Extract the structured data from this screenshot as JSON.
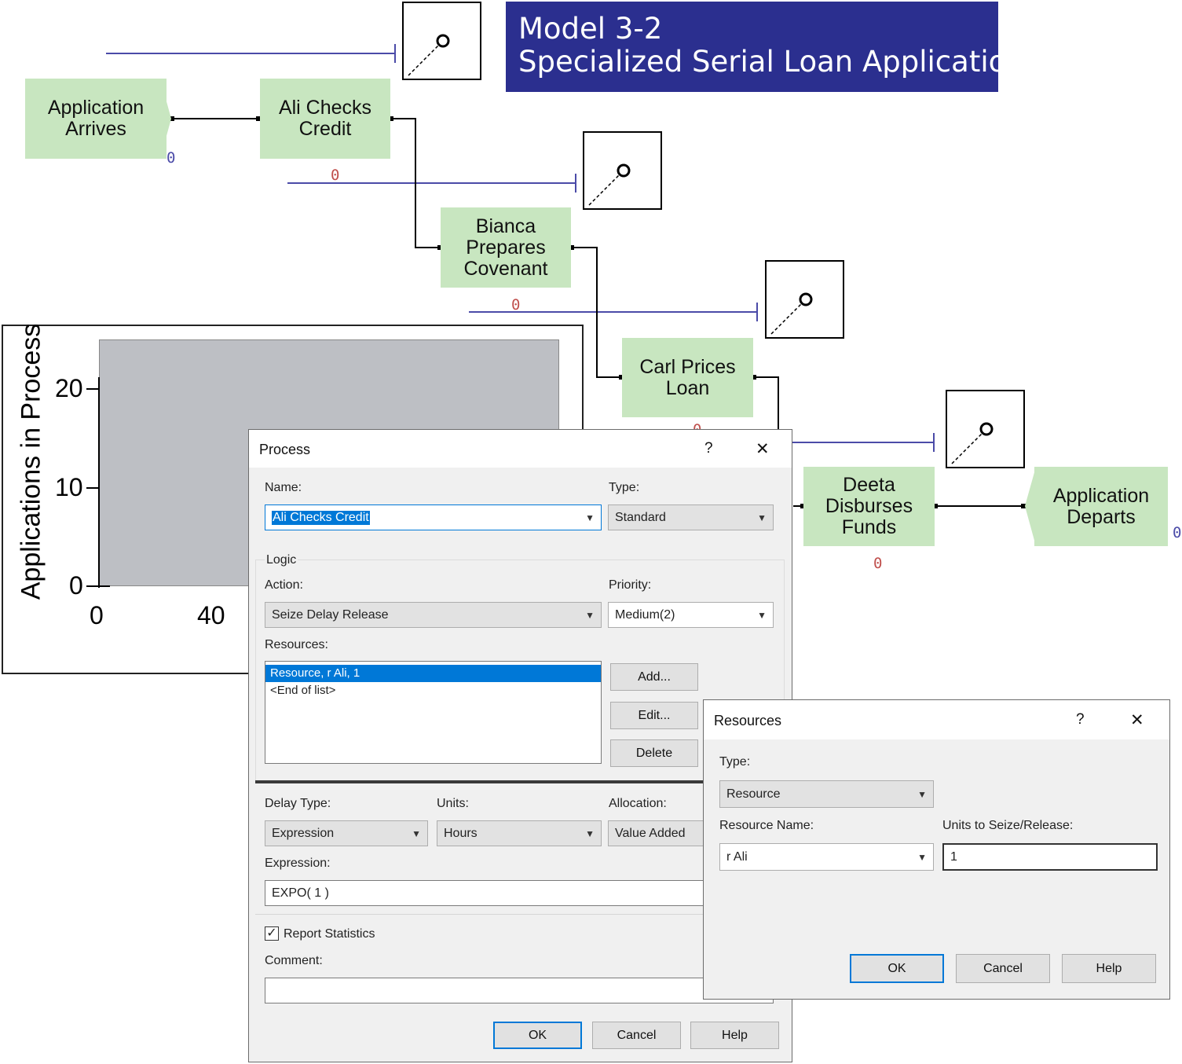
{
  "banner": {
    "line1": "Model 3-2",
    "line2": "Specialized Serial Loan Application"
  },
  "blocks": {
    "arrive": "Application\nArrives",
    "ali": "Ali Checks\nCredit",
    "bianca": "Bianca\nPrepares\nCovenant",
    "carl": "Carl Prices\nLoan",
    "deeta": "Deeta\nDisburses\nFunds",
    "depart": "Application\nDeparts"
  },
  "counters": {
    "arrive": "0",
    "ali": "0",
    "bianca": "0",
    "carl": "0",
    "deeta": "0",
    "depart": "0"
  },
  "plot": {
    "ylabel": "Applications in Process",
    "yticks": [
      "20",
      "10",
      "0"
    ],
    "xticks": [
      "0",
      "40"
    ]
  },
  "process_dialog": {
    "title": "Process",
    "help": "?",
    "close": "✕",
    "name_label": "Name:",
    "name_value": "Ali Checks Credit",
    "type_label": "Type:",
    "type_value": "Standard",
    "logic_label": "Logic",
    "action_label": "Action:",
    "action_value": "Seize Delay Release",
    "priority_label": "Priority:",
    "priority_value": "Medium(2)",
    "resources_label": "Resources:",
    "resources_list": [
      "Resource, r Ali, 1",
      "<End of list>"
    ],
    "add_button": "Add...",
    "edit_button": "Edit...",
    "delete_button": "Delete",
    "delay_type_label": "Delay Type:",
    "delay_type_value": "Expression",
    "units_label": "Units:",
    "units_value": "Hours",
    "allocation_label": "Allocation:",
    "allocation_value": "Value Added",
    "expression_label": "Expression:",
    "expression_value": "EXPO( 1 )",
    "report_stats_label": "Report Statistics",
    "report_stats_checked": true,
    "comment_label": "Comment:",
    "comment_value": "",
    "ok": "OK",
    "cancel": "Cancel",
    "help_button": "Help"
  },
  "resources_dialog": {
    "title": "Resources",
    "help": "?",
    "close": "✕",
    "type_label": "Type:",
    "type_value": "Resource",
    "name_label": "Resource Name:",
    "name_value": "r Ali",
    "units_label": "Units to Seize/Release:",
    "units_value": "1",
    "ok": "OK",
    "cancel": "Cancel",
    "help_button": "Help"
  },
  "colors": {
    "banner": "#2b2f8f",
    "block": "#c8e6c0",
    "resource_line": "#4b4ba8",
    "plot_area": "#bdbfc4",
    "selection": "#0078d7"
  }
}
